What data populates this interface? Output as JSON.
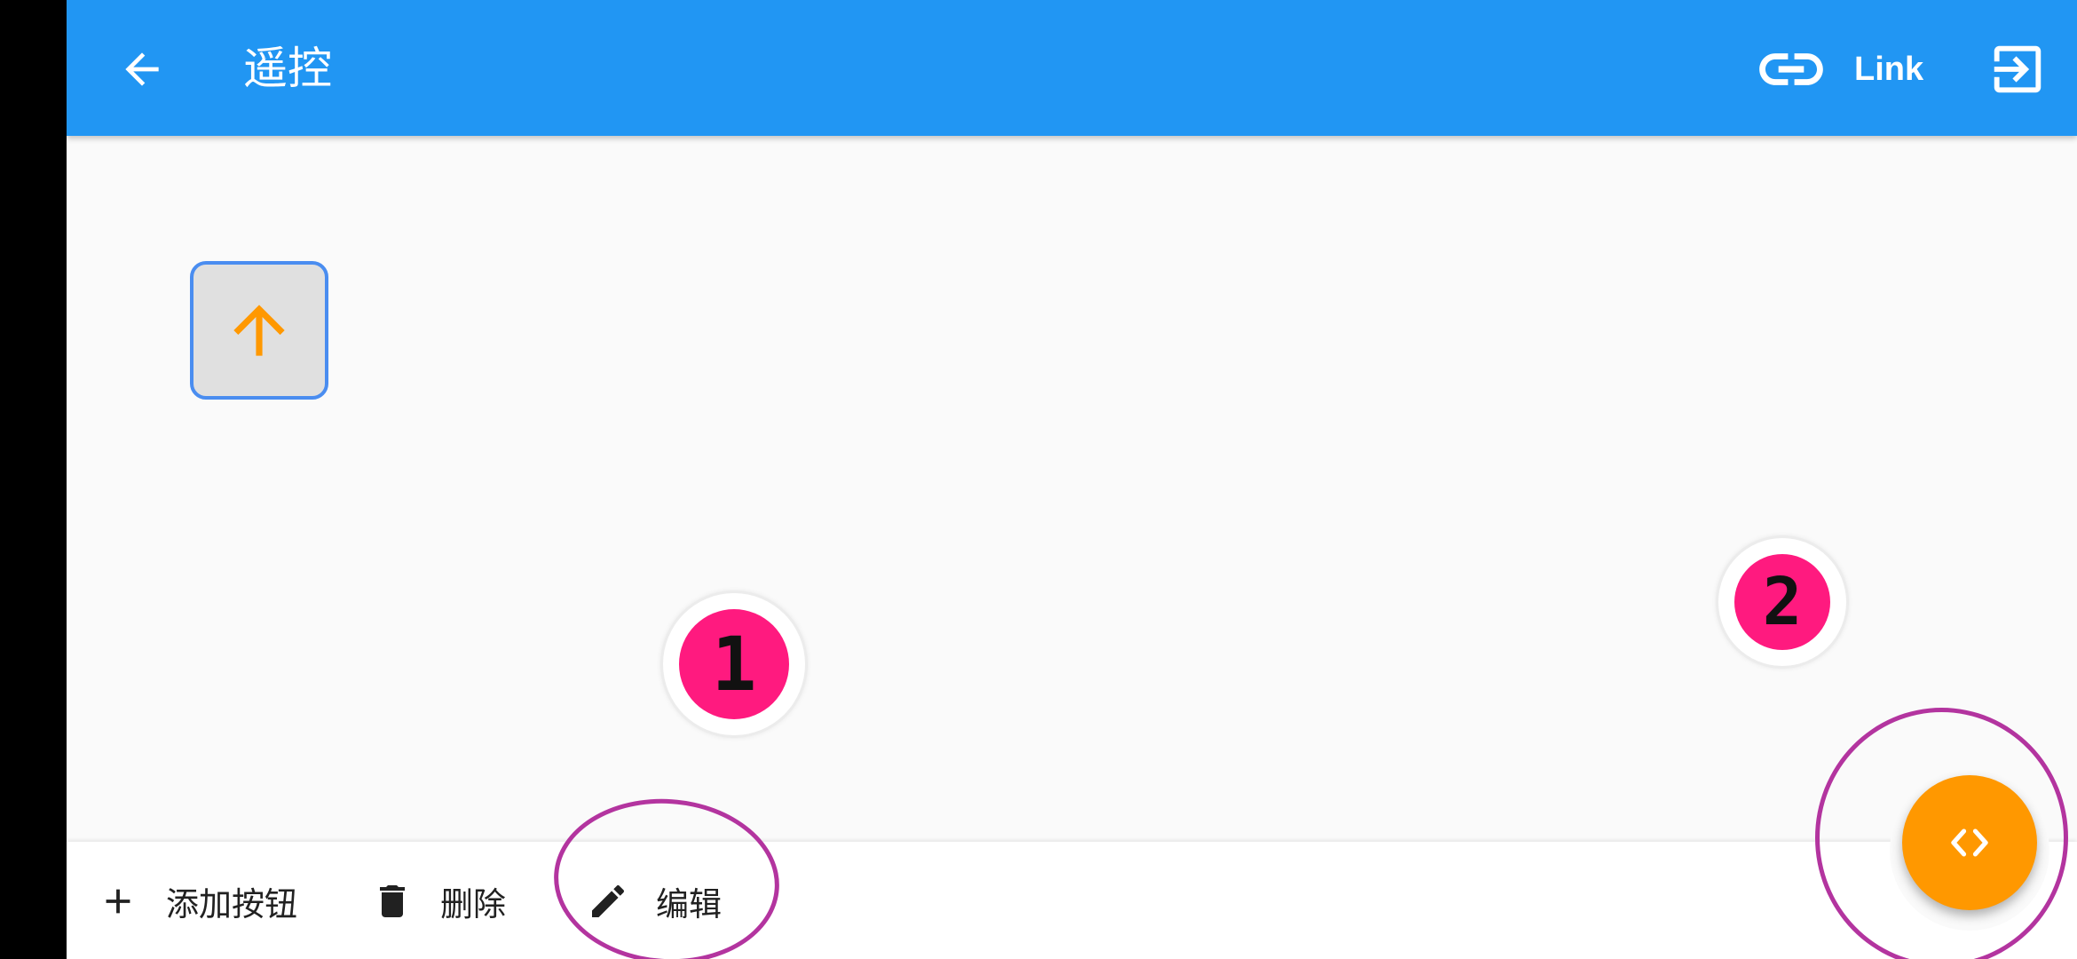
{
  "appbar": {
    "title": "遥控",
    "link_label": "Link",
    "color": "#2196f3"
  },
  "icons": {
    "back": "arrow-left-icon",
    "link": "link-icon",
    "exit": "exit-to-app-icon",
    "remote_key": "arrow-up-icon",
    "add": "plus-icon",
    "delete": "trash-icon",
    "edit": "pencil-icon",
    "fab": "code-icon"
  },
  "markers": [
    {
      "label": "1"
    },
    {
      "label": "2"
    }
  ],
  "bottom_actions": {
    "add_label": "添加按钮",
    "delete_label": "删除",
    "edit_label": "编辑"
  },
  "colors": {
    "accent": "#ff9800",
    "marker": "#ff1a7f",
    "annotation": "#b3349f",
    "key_border": "#4a8df0"
  }
}
